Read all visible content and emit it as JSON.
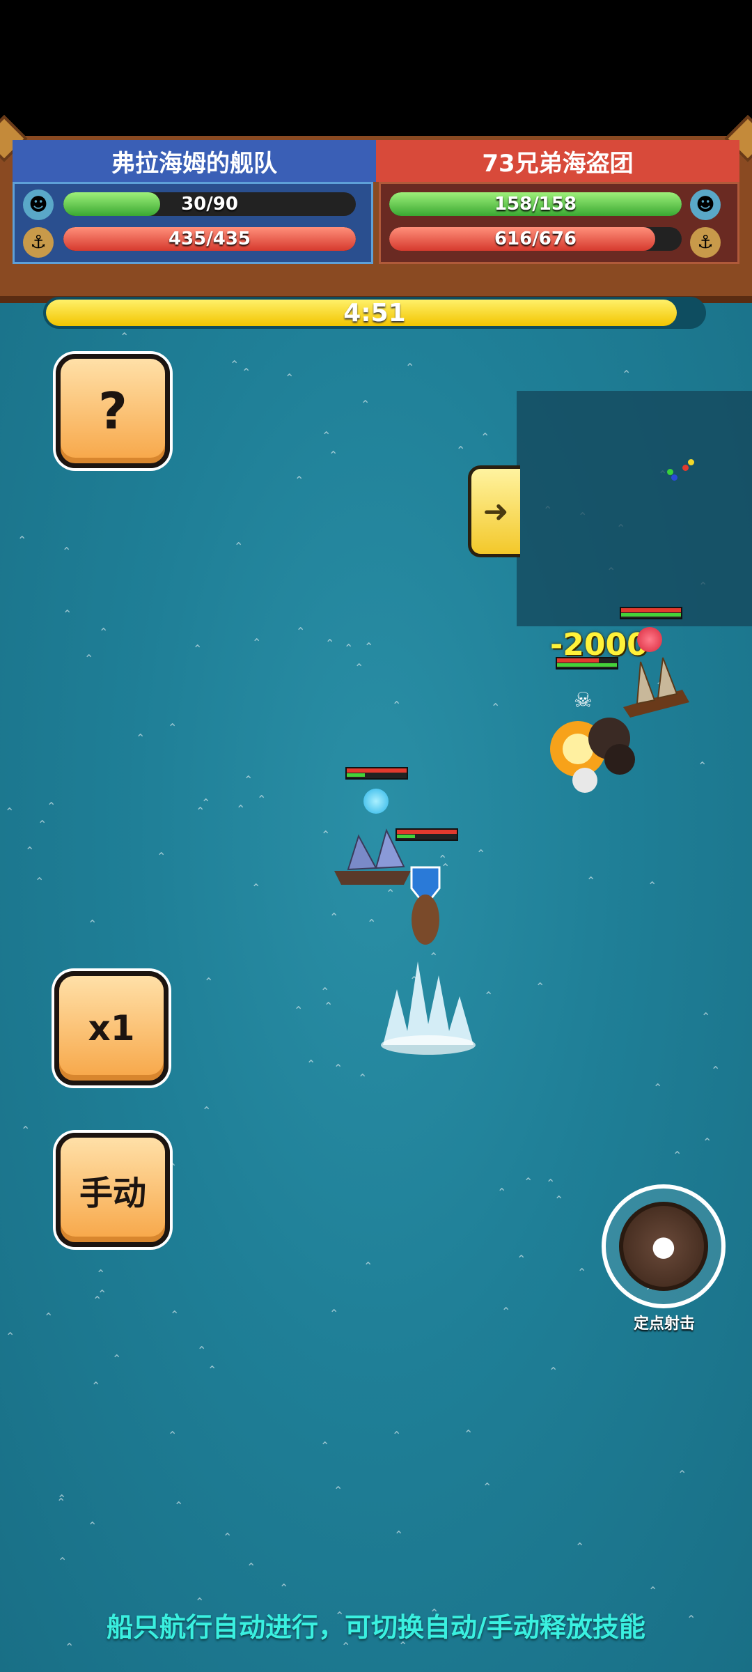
{
  "header": {
    "left_team": "弗拉海姆的舰队",
    "right_team": "73兄弟海盗团",
    "left_crew": "30/90",
    "left_crew_fraction": 0.33,
    "left_hull": "435/435",
    "left_hull_fraction": 1.0,
    "right_crew": "158/158",
    "right_crew_fraction": 1.0,
    "right_hull": "616/676",
    "right_hull_fraction": 0.91
  },
  "timer": {
    "text": "4:51",
    "fraction": 0.96
  },
  "buttons": {
    "help": "?",
    "speed": "x1",
    "mode": "手动"
  },
  "skill": {
    "label": "定点射击"
  },
  "damage_text": "-2000",
  "caption": "船只航行自动进行，可切换自动/手动释放技能",
  "colors": {
    "ally": "#3a5fb6",
    "enemy": "#d84a3a",
    "sea": "#1f7f97",
    "caption": "#3af0e0"
  }
}
